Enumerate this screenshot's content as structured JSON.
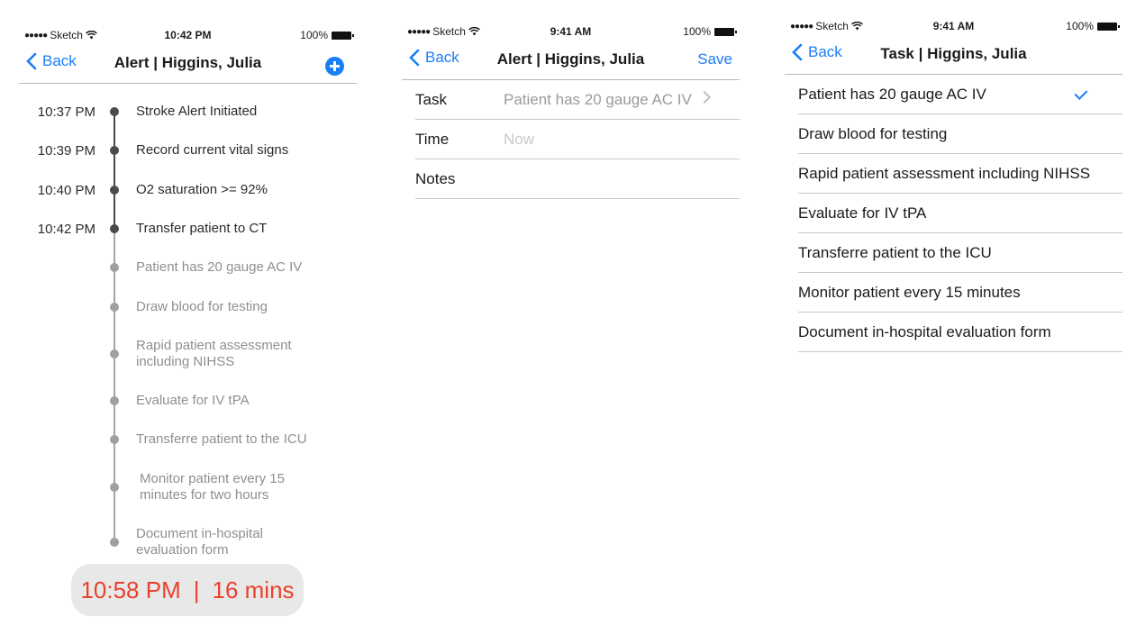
{
  "colors": {
    "accent": "#1a7ef5",
    "timer_text": "#e8412d",
    "timer_bg": "#e8e8e8",
    "timeline_dark": "#4a4a4a",
    "timeline_light": "#a0a0a0"
  },
  "screen1": {
    "status": {
      "carrier": "Sketch",
      "time": "10:42 PM",
      "battery": "100%"
    },
    "nav": {
      "back": "Back",
      "title": "Alert | Higgins, Julia",
      "action_icon": "plus-circle-icon"
    },
    "timeline": [
      {
        "time": "10:37 PM",
        "label": "Stroke Alert Initiated",
        "done": true
      },
      {
        "time": "10:39 PM",
        "label": "Record current vital signs",
        "done": true
      },
      {
        "time": "10:40 PM",
        "label": "O2 saturation >= 92%",
        "done": true
      },
      {
        "time": "10:42 PM",
        "label": "Transfer patient to CT",
        "done": true
      },
      {
        "time": "",
        "label": "Patient has 20 gauge AC IV",
        "done": false
      },
      {
        "time": "",
        "label": "Draw blood for testing",
        "done": false
      },
      {
        "time": "",
        "label": "Rapid patient assessment including NIHSS",
        "done": false
      },
      {
        "time": "",
        "label": "Evaluate for IV tPA",
        "done": false
      },
      {
        "time": "",
        "label": "Transferre patient to the ICU",
        "done": false
      },
      {
        "time": "",
        "label": "Monitor patient every 15 minutes for two hours",
        "done": false
      },
      {
        "time": "",
        "label": "Document in-hospital evaluation form",
        "done": false
      }
    ],
    "timer": {
      "time": "10:58 PM",
      "separator": "|",
      "duration": "16 mins"
    }
  },
  "screen2": {
    "status": {
      "carrier": "Sketch",
      "time": "9:41 AM",
      "battery": "100%"
    },
    "nav": {
      "back": "Back",
      "title": "Alert | Higgins, Julia",
      "save": "Save"
    },
    "form": [
      {
        "label": "Task",
        "value": "Patient has 20 gauge AC IV",
        "placeholder": ""
      },
      {
        "label": "Time",
        "value": "",
        "placeholder": "Now"
      },
      {
        "label": "Notes",
        "value": "",
        "placeholder": ""
      }
    ]
  },
  "screen3": {
    "status": {
      "carrier": "Sketch",
      "time": "9:41 AM",
      "battery": "100%"
    },
    "nav": {
      "back": "Back",
      "title": "Task | Higgins, Julia"
    },
    "tasks": [
      {
        "label": "Patient has 20 gauge AC IV",
        "selected": true
      },
      {
        "label": "Draw blood for testing",
        "selected": false
      },
      {
        "label": "Rapid patient assessment including NIHSS",
        "selected": false
      },
      {
        "label": "Evaluate for IV tPA",
        "selected": false
      },
      {
        "label": "Transferre patient to the ICU",
        "selected": false
      },
      {
        "label": "Monitor patient every 15 minutes",
        "selected": false
      },
      {
        "label": "Document in-hospital evaluation form",
        "selected": false
      }
    ]
  }
}
